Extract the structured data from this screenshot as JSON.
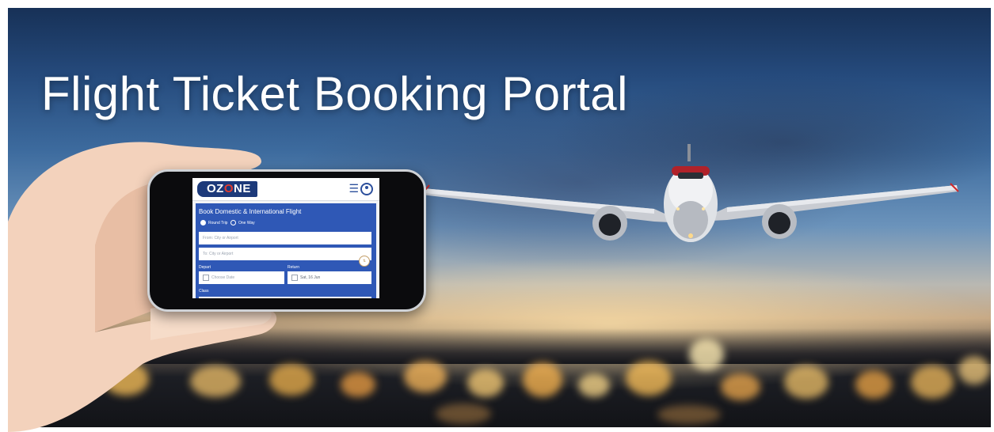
{
  "banner": {
    "title": "Flight Ticket Booking Portal"
  },
  "app": {
    "logo": {
      "prefix": "OZ",
      "mid": "O",
      "suffix": "NE"
    },
    "menu_icon": "hamburger-menu-icon",
    "user_icon": "user-circle-icon",
    "form": {
      "title": "Book Domestic & International Flight",
      "trip_options": [
        "Round Trip",
        "One Way"
      ],
      "from_placeholder": "From: City or Airport",
      "to_placeholder": "To: City or Airport",
      "depart_label": "Depart",
      "depart_placeholder": "Choose Date",
      "return_label": "Return",
      "return_value": "Sat, 16 Jun",
      "class_label": "Class",
      "swap_icon": "swap-arrows-icon",
      "calendar_icon": "calendar-icon"
    }
  },
  "colors": {
    "form_blue": "#2f58b6",
    "logo_navy": "#1d3a7a",
    "logo_red": "#e23b2e"
  }
}
